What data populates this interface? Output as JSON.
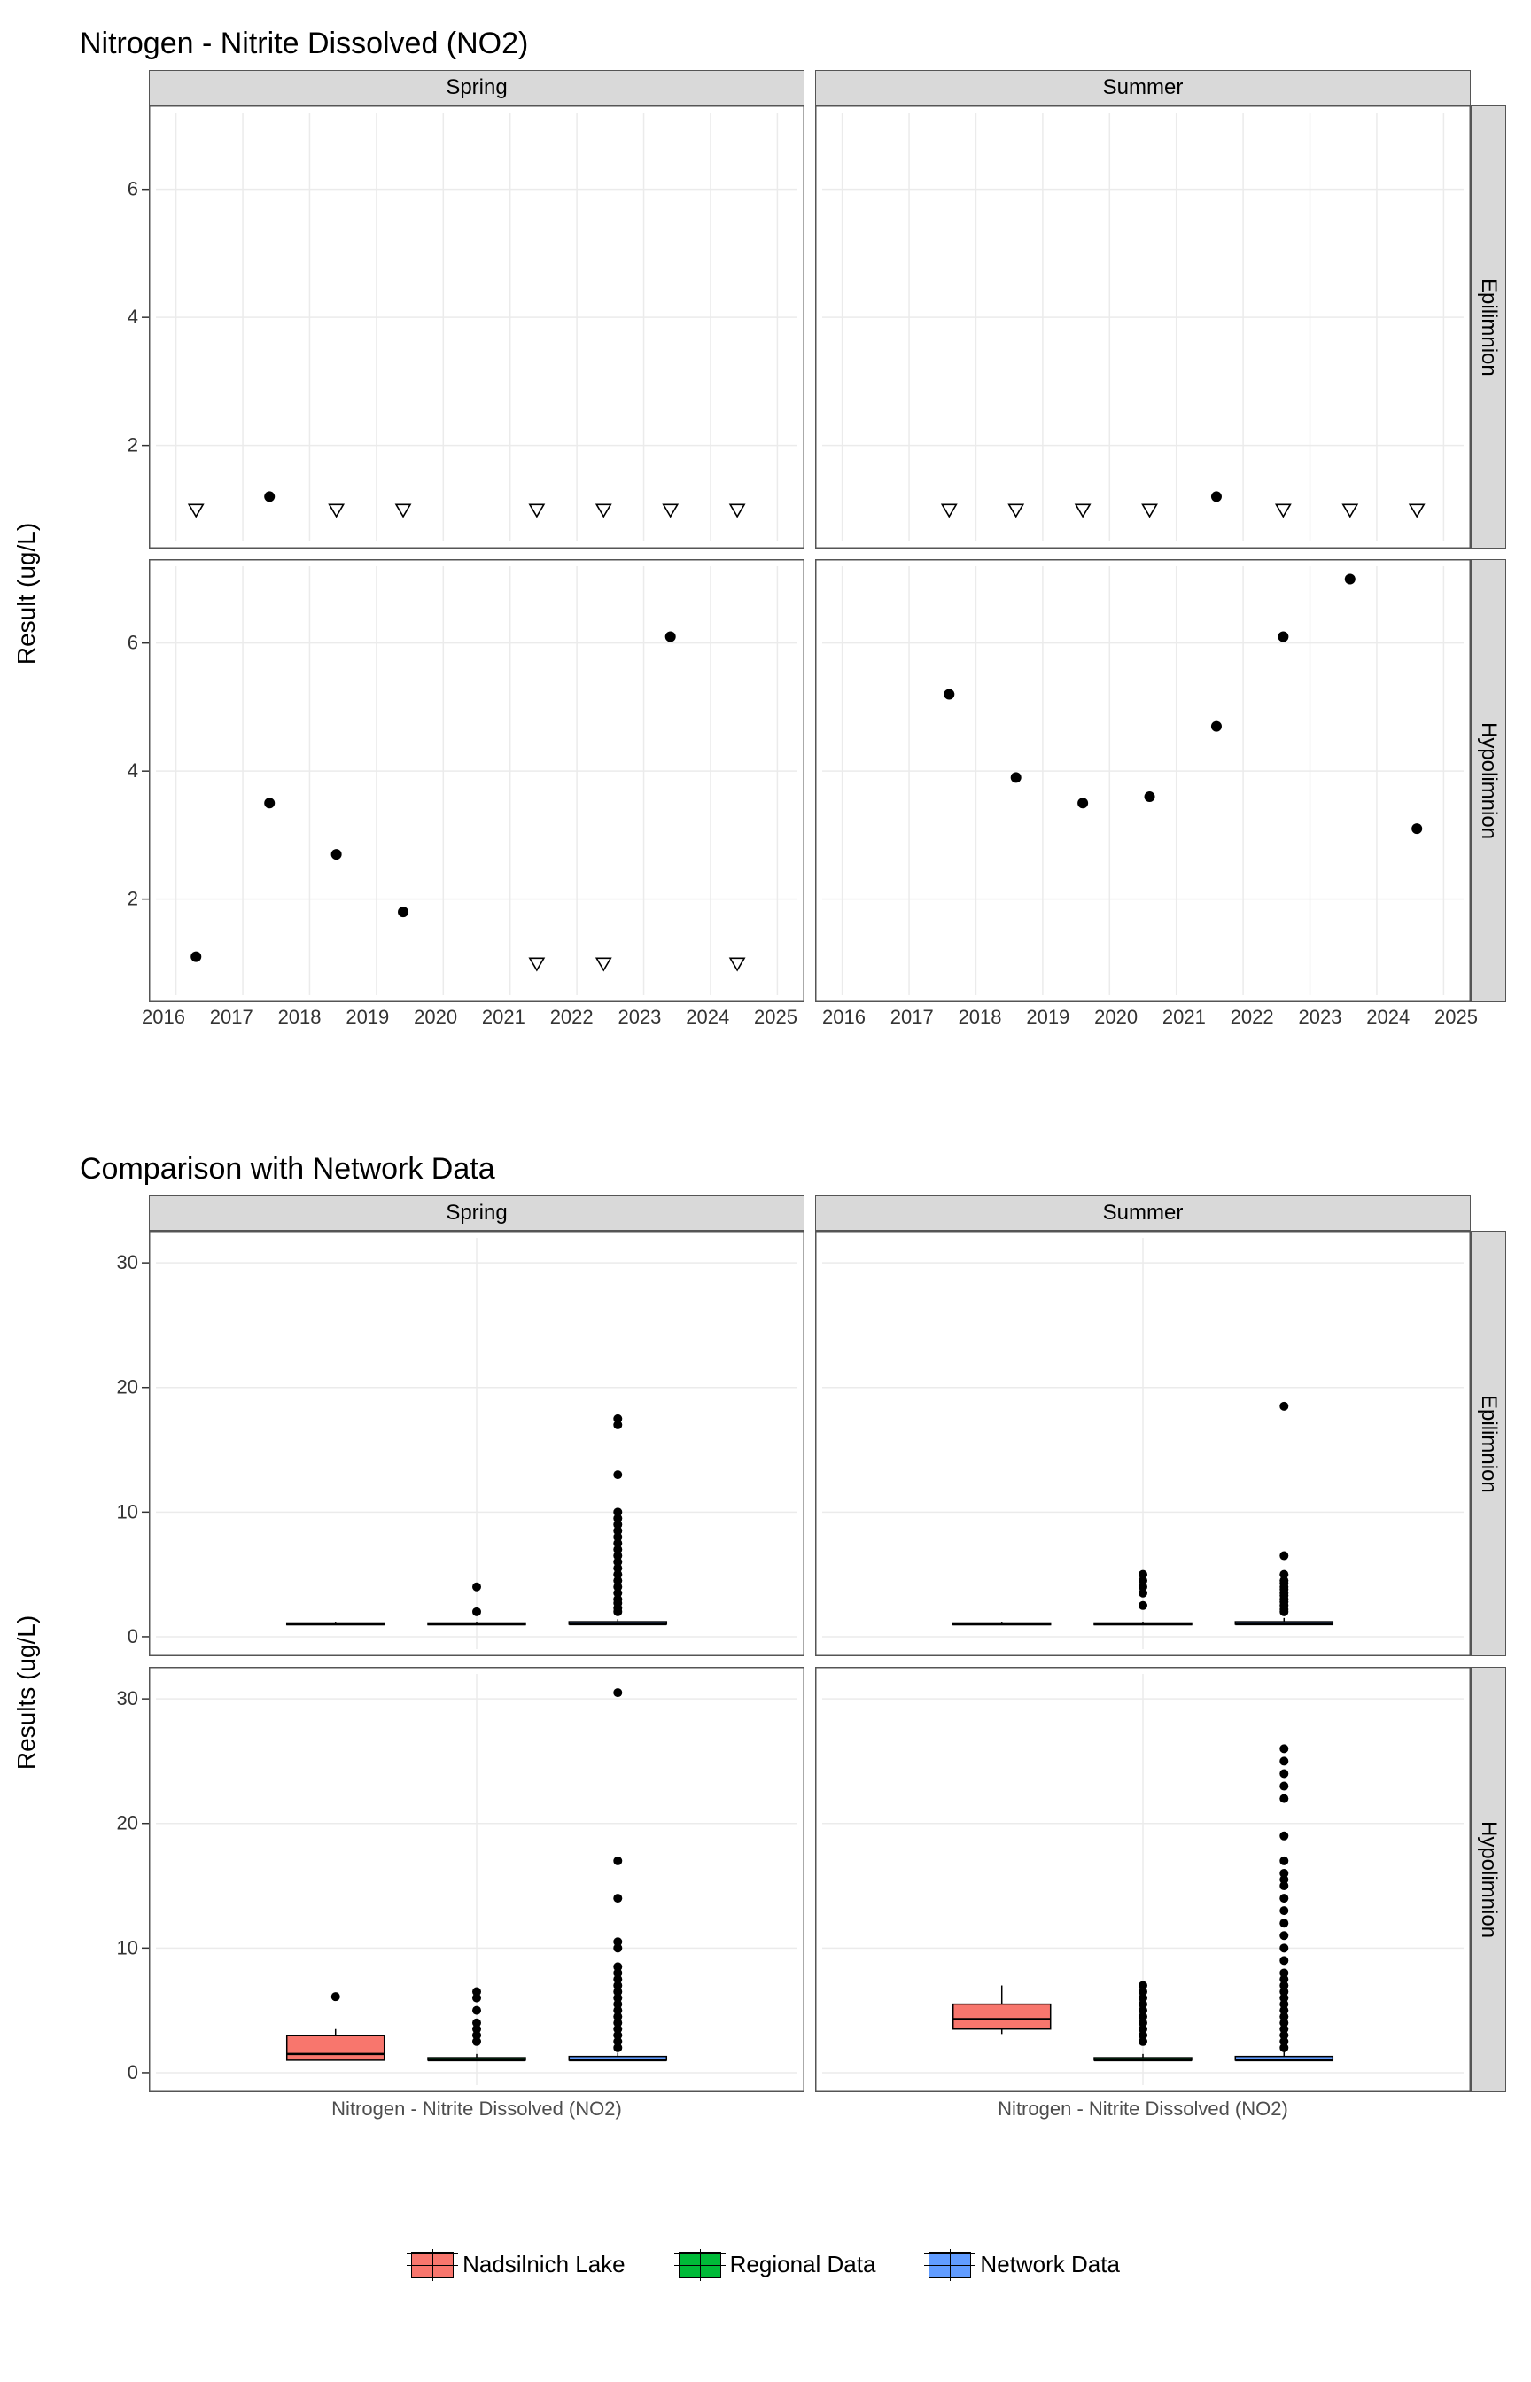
{
  "chart_data": [
    {
      "id": "top",
      "type": "scatter",
      "title": "Nitrogen - Nitrite Dissolved (NO2)",
      "ylabel": "Result (ug/L)",
      "xlabel": "",
      "x_ticks": [
        2016,
        2017,
        2018,
        2019,
        2020,
        2021,
        2022,
        2023,
        2024,
        2025
      ],
      "y_ticks": [
        2,
        4,
        6
      ],
      "ylim": [
        0.5,
        7.2
      ],
      "xlim": [
        2015.7,
        2025.3
      ],
      "col_facets": [
        "Spring",
        "Summer"
      ],
      "row_facets": [
        "Epilimnion",
        "Hypolimnion"
      ],
      "panels": {
        "Spring|Epilimnion": {
          "points": [
            {
              "x": 2016.3,
              "y": 1.0,
              "shape": "open"
            },
            {
              "x": 2017.4,
              "y": 1.2,
              "shape": "filled"
            },
            {
              "x": 2018.4,
              "y": 1.0,
              "shape": "open"
            },
            {
              "x": 2019.4,
              "y": 1.0,
              "shape": "open"
            },
            {
              "x": 2021.4,
              "y": 1.0,
              "shape": "open"
            },
            {
              "x": 2022.4,
              "y": 1.0,
              "shape": "open"
            },
            {
              "x": 2023.4,
              "y": 1.0,
              "shape": "open"
            },
            {
              "x": 2024.4,
              "y": 1.0,
              "shape": "open"
            }
          ]
        },
        "Summer|Epilimnion": {
          "points": [
            {
              "x": 2017.6,
              "y": 1.0,
              "shape": "open"
            },
            {
              "x": 2018.6,
              "y": 1.0,
              "shape": "open"
            },
            {
              "x": 2019.6,
              "y": 1.0,
              "shape": "open"
            },
            {
              "x": 2020.6,
              "y": 1.0,
              "shape": "open"
            },
            {
              "x": 2021.6,
              "y": 1.2,
              "shape": "filled"
            },
            {
              "x": 2022.6,
              "y": 1.0,
              "shape": "open"
            },
            {
              "x": 2023.6,
              "y": 1.0,
              "shape": "open"
            },
            {
              "x": 2024.6,
              "y": 1.0,
              "shape": "open"
            }
          ]
        },
        "Spring|Hypolimnion": {
          "points": [
            {
              "x": 2016.3,
              "y": 1.1,
              "shape": "filled"
            },
            {
              "x": 2017.4,
              "y": 3.5,
              "shape": "filled"
            },
            {
              "x": 2018.4,
              "y": 2.7,
              "shape": "filled"
            },
            {
              "x": 2019.4,
              "y": 1.8,
              "shape": "filled"
            },
            {
              "x": 2021.4,
              "y": 1.0,
              "shape": "open"
            },
            {
              "x": 2022.4,
              "y": 1.0,
              "shape": "open"
            },
            {
              "x": 2023.4,
              "y": 6.1,
              "shape": "filled"
            },
            {
              "x": 2024.4,
              "y": 1.0,
              "shape": "open"
            }
          ]
        },
        "Summer|Hypolimnion": {
          "points": [
            {
              "x": 2017.6,
              "y": 5.2,
              "shape": "filled"
            },
            {
              "x": 2018.6,
              "y": 3.9,
              "shape": "filled"
            },
            {
              "x": 2019.6,
              "y": 3.5,
              "shape": "filled"
            },
            {
              "x": 2020.6,
              "y": 3.6,
              "shape": "filled"
            },
            {
              "x": 2021.6,
              "y": 4.7,
              "shape": "filled"
            },
            {
              "x": 2022.6,
              "y": 6.1,
              "shape": "filled"
            },
            {
              "x": 2023.6,
              "y": 7.0,
              "shape": "filled"
            },
            {
              "x": 2024.6,
              "y": 3.1,
              "shape": "filled"
            }
          ]
        }
      }
    },
    {
      "id": "bottom",
      "type": "boxplot",
      "title": "Comparison with Network Data",
      "ylabel": "Results (ug/L)",
      "xlabel": "Nitrogen - Nitrite Dissolved (NO2)",
      "y_ticks": [
        0,
        10,
        20,
        30
      ],
      "ylim": [
        -1,
        32
      ],
      "col_facets": [
        "Spring",
        "Summer"
      ],
      "row_facets": [
        "Epilimnion",
        "Hypolimnion"
      ],
      "groups": [
        "Nadsilnich Lake",
        "Regional Data",
        "Network Data"
      ],
      "group_colors": {
        "Nadsilnich Lake": "#f8766d",
        "Regional Data": "#00ba38",
        "Network Data": "#619cff"
      },
      "panels": {
        "Spring|Epilimnion": {
          "boxes": [
            {
              "group": "Nadsilnich Lake",
              "min": 1.0,
              "q1": 1.0,
              "med": 1.0,
              "q3": 1.1,
              "max": 1.2,
              "outliers": []
            },
            {
              "group": "Regional Data",
              "min": 1.0,
              "q1": 1.0,
              "med": 1.0,
              "q3": 1.1,
              "max": 1.2,
              "outliers": [
                2.0,
                4.0
              ]
            },
            {
              "group": "Network Data",
              "min": 1.0,
              "q1": 1.0,
              "med": 1.0,
              "q3": 1.2,
              "max": 1.4,
              "outliers": [
                2,
                2.3,
                2.7,
                3,
                3.5,
                4,
                4.5,
                5,
                5.5,
                6,
                6.5,
                7,
                7.5,
                8,
                8.5,
                9,
                9.5,
                10,
                13,
                17,
                17.5
              ]
            }
          ]
        },
        "Summer|Epilimnion": {
          "boxes": [
            {
              "group": "Nadsilnich Lake",
              "min": 1.0,
              "q1": 1.0,
              "med": 1.0,
              "q3": 1.1,
              "max": 1.2,
              "outliers": []
            },
            {
              "group": "Regional Data",
              "min": 1.0,
              "q1": 1.0,
              "med": 1.0,
              "q3": 1.1,
              "max": 1.2,
              "outliers": [
                2.5,
                3.5,
                4.0,
                4.5,
                5.0
              ]
            },
            {
              "group": "Network Data",
              "min": 1.0,
              "q1": 1.0,
              "med": 1.0,
              "q3": 1.2,
              "max": 1.5,
              "outliers": [
                2,
                2.2,
                2.5,
                2.8,
                3,
                3.3,
                3.5,
                3.8,
                4,
                4.3,
                4.5,
                5,
                6.5,
                18.5
              ]
            }
          ]
        },
        "Spring|Hypolimnion": {
          "boxes": [
            {
              "group": "Nadsilnich Lake",
              "min": 1.0,
              "q1": 1.0,
              "med": 1.5,
              "q3": 3.0,
              "max": 3.5,
              "outliers": [
                6.1
              ]
            },
            {
              "group": "Regional Data",
              "min": 1.0,
              "q1": 1.0,
              "med": 1.0,
              "q3": 1.2,
              "max": 1.5,
              "outliers": [
                2.5,
                3,
                3.5,
                4,
                5,
                6,
                6.5
              ]
            },
            {
              "group": "Network Data",
              "min": 1.0,
              "q1": 1.0,
              "med": 1.0,
              "q3": 1.3,
              "max": 1.6,
              "outliers": [
                2,
                2.5,
                3,
                3.5,
                4,
                4.5,
                5,
                5.5,
                6,
                6.5,
                7,
                7.5,
                8,
                8.5,
                10,
                10.5,
                14,
                17,
                30.5
              ]
            }
          ]
        },
        "Summer|Hypolimnion": {
          "boxes": [
            {
              "group": "Nadsilnich Lake",
              "min": 3.1,
              "q1": 3.5,
              "med": 4.3,
              "q3": 5.5,
              "max": 7.0,
              "outliers": []
            },
            {
              "group": "Regional Data",
              "min": 1.0,
              "q1": 1.0,
              "med": 1.0,
              "q3": 1.2,
              "max": 1.5,
              "outliers": [
                2.5,
                3,
                3.5,
                4,
                4.5,
                5,
                5.5,
                6,
                6.5,
                7
              ]
            },
            {
              "group": "Network Data",
              "min": 1.0,
              "q1": 1.0,
              "med": 1.0,
              "q3": 1.3,
              "max": 1.7,
              "outliers": [
                2,
                2.5,
                3,
                3.5,
                4,
                4.5,
                5,
                5.5,
                6,
                6.5,
                7,
                7.5,
                8,
                9,
                10,
                11,
                12,
                13,
                14,
                15,
                15.5,
                16,
                17,
                19,
                22,
                23,
                24,
                25,
                26
              ]
            }
          ]
        }
      },
      "legend": [
        {
          "label": "Nadsilnich Lake",
          "color": "#f8766d"
        },
        {
          "label": "Regional Data",
          "color": "#00ba38"
        },
        {
          "label": "Network Data",
          "color": "#619cff"
        }
      ]
    }
  ]
}
